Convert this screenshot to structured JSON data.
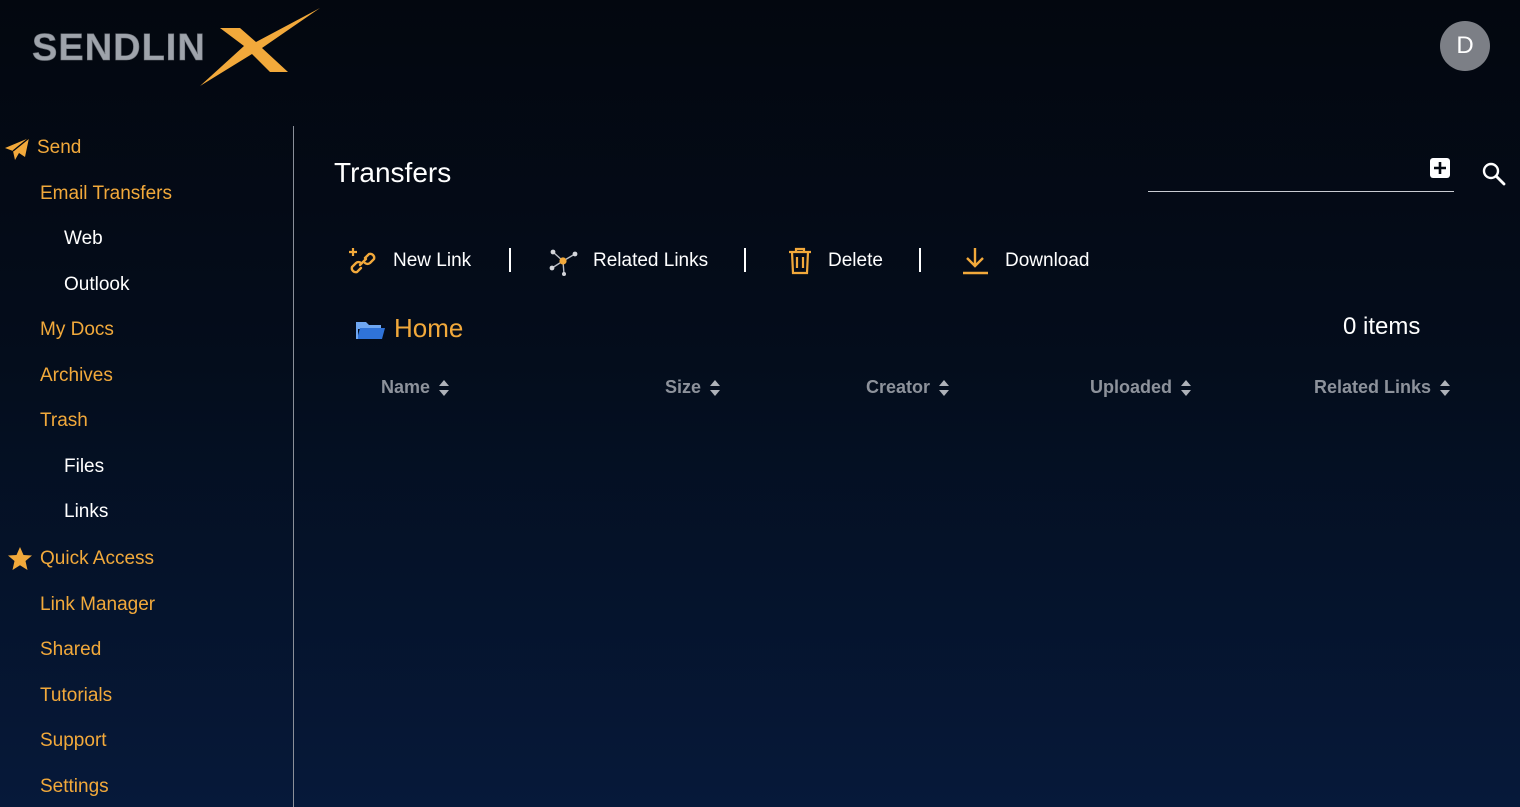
{
  "brand": {
    "name": "SENDLIN",
    "accent": "#f2a93b"
  },
  "user": {
    "initial": "D"
  },
  "sidebar": {
    "items": [
      {
        "label": "Send",
        "icon": "paper-plane-icon"
      },
      {
        "label": "Email Transfers"
      },
      {
        "label": "Web"
      },
      {
        "label": "Outlook"
      },
      {
        "label": "My Docs"
      },
      {
        "label": "Archives"
      },
      {
        "label": "Trash"
      },
      {
        "label": "Files"
      },
      {
        "label": "Links"
      },
      {
        "label": "Quick Access",
        "icon": "star-icon"
      },
      {
        "label": "Link Manager"
      },
      {
        "label": "Shared"
      },
      {
        "label": "Tutorials"
      },
      {
        "label": "Support"
      },
      {
        "label": "Settings"
      }
    ]
  },
  "main": {
    "title": "Transfers",
    "search": {
      "value": "",
      "placeholder": ""
    },
    "toolbar": {
      "new_link": "New Link",
      "related_links": "Related Links",
      "delete": "Delete",
      "download": "Download"
    },
    "folder": {
      "name": "Home",
      "icon": "folder-open-icon"
    },
    "items_count": "0 items",
    "columns": [
      "Name",
      "Size",
      "Creator",
      "Uploaded",
      "Related Links"
    ]
  }
}
